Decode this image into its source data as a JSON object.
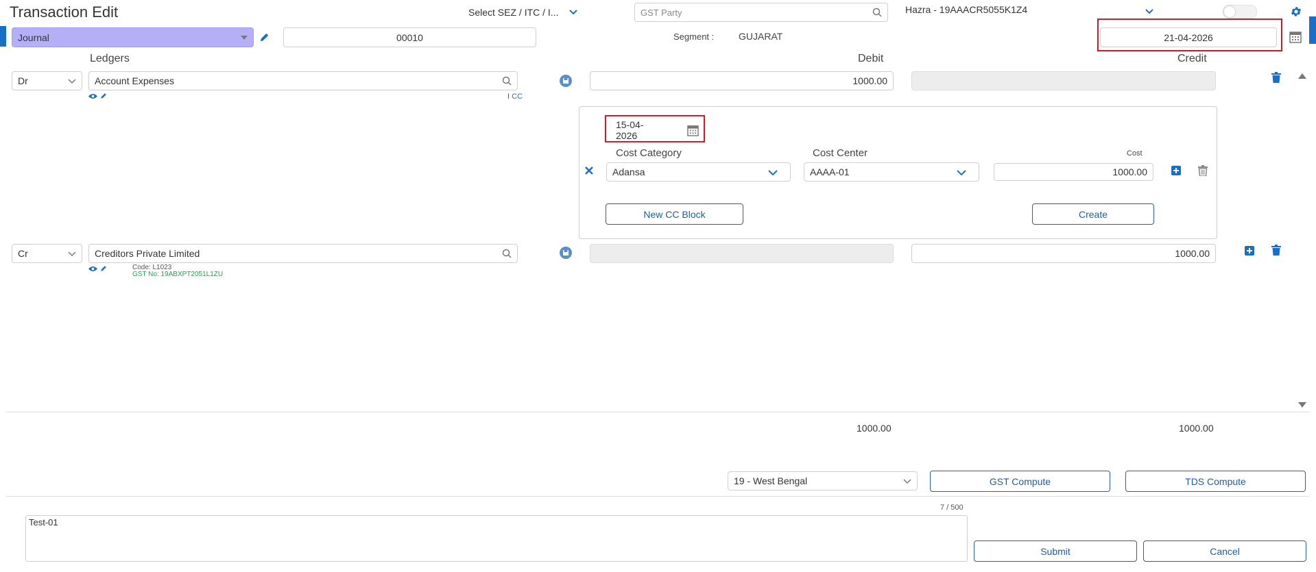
{
  "header": {
    "title": "Transaction Edit",
    "sez_select": "Select SEZ / ITC / I...",
    "gst_party_placeholder": "GST Party",
    "company": "Hazra - 19AAACR5055K1Z4"
  },
  "voucher": {
    "type": "Journal",
    "number": "00010",
    "segment_label": "Segment :",
    "segment_value": "GUJARAT",
    "date": "21-04-2026"
  },
  "columns": {
    "ledgers": "Ledgers",
    "debit": "Debit",
    "credit": "Credit"
  },
  "rows": [
    {
      "drcr": "Dr",
      "ledger": "Account Expenses",
      "tag": "CC",
      "debit": "1000.00",
      "credit": ""
    },
    {
      "drcr": "Cr",
      "ledger": "Creditors Private Limited",
      "code": "Code: L1023",
      "gst": "GST No: 19ABXPT2051L1ZU",
      "debit": "",
      "credit": "1000.00"
    }
  ],
  "cc_block": {
    "date": "15-04-2026",
    "category_label": "Cost Category",
    "center_label": "Cost Center",
    "cost_label": "Cost",
    "category_value": "Adansa",
    "center_value": "AAAA-01",
    "cost_value": "1000.00",
    "new_cc_button": "New CC Block",
    "create_button": "Create"
  },
  "totals": {
    "debit": "1000.00",
    "credit": "1000.00"
  },
  "gst": {
    "state": "19 - West Bengal",
    "gst_compute": "GST Compute",
    "tds_compute": "TDS Compute"
  },
  "narration": {
    "text": "Test-01",
    "counter": "7 / 500"
  },
  "actions": {
    "submit": "Submit",
    "cancel": "Cancel"
  },
  "colors": {
    "accent": "#1a6fc4",
    "journal_bg": "#b4aff7",
    "highlight": "#e0141b",
    "gst_green": "#2e9a55"
  }
}
